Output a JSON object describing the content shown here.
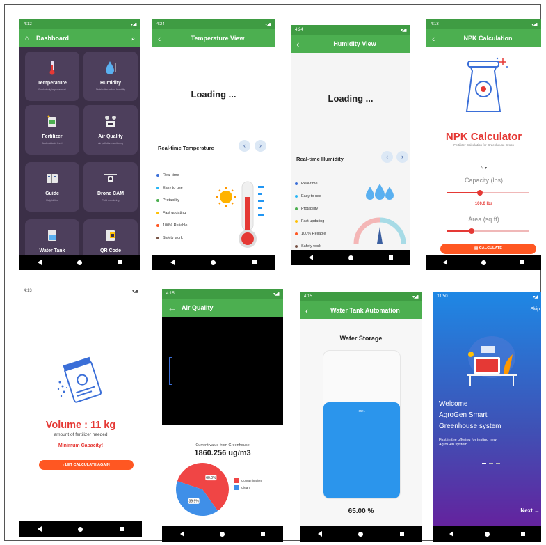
{
  "dashboard": {
    "time": "4:12",
    "title": "Dashboard",
    "tiles": [
      {
        "title": "Temperature",
        "sub": "Productivity improvement"
      },
      {
        "title": "Humidity",
        "sub": "Distribution indoor humidity"
      },
      {
        "title": "Fertilizer",
        "sub": "Add nutrients level"
      },
      {
        "title": "Air Quality",
        "sub": "Air pollution monitoring"
      },
      {
        "title": "Guide",
        "sub": "Helpful tips"
      },
      {
        "title": "Drone CAM",
        "sub": "Field monitoring"
      },
      {
        "title": "Water Tank",
        "sub": "Indicating water level and"
      },
      {
        "title": "QR Code",
        "sub": "Indicating your device and"
      }
    ]
  },
  "temperature": {
    "time": "4:24",
    "title": "Temperature View",
    "loading": "Loading ...",
    "section": "Real-time Temperature",
    "features": [
      "Real-time",
      "Easy to use",
      "Protability",
      "Fast updating",
      "100% Reliable",
      "Safety work"
    ]
  },
  "humidity": {
    "time": "4:24",
    "title": "Humidity View",
    "loading": "Loading ...",
    "section": "Real-time Humidity",
    "features": [
      "Real-time",
      "Easy to use",
      "Protability",
      "Fast updating",
      "100% Reliable",
      "Safety work"
    ]
  },
  "npk": {
    "time": "4:13",
    "title": "NPK Calculation",
    "heading": "NPK Calculator",
    "subheading": "Fertilizer Calculation for Greenhouse Crops",
    "dropdown": "N",
    "capacity_label": "Capacity (lbs)",
    "capacity_value": "100.0 lbs",
    "capacity_level": 0.4,
    "area_label": "Area (sq ft)",
    "area_level": 0.3,
    "button": "CALCULATE"
  },
  "volume": {
    "time": "4:13",
    "heading": "Volume : 11 kg",
    "sub": "amount of fertilizer needed",
    "warning": "Minimum Capacity!",
    "button": "LET CALCULATE AGAIN"
  },
  "air": {
    "time": "4:15",
    "title": "Air Quality",
    "caption": "Current value from Greenhouse",
    "value": "1860.256 ug/m3",
    "chart_data": {
      "type": "pie",
      "categories": [
        "Contamination",
        "Clean"
      ],
      "values": [
        60.0,
        39.9
      ],
      "labels": [
        "60.0%",
        "39.9%"
      ],
      "colors": [
        "#f04545",
        "#3f8fe8"
      ],
      "legend": "right"
    }
  },
  "water": {
    "time": "4:15",
    "title": "Water Tank Automation",
    "heading": "Water Storage",
    "level_label": "65%",
    "level": 0.65,
    "reading": "65.00 %"
  },
  "welcome": {
    "time": "11:50",
    "skip": "Skip",
    "line1": "Welcome",
    "line2": "AgroGen Smart",
    "line3": "Greenhouse system",
    "desc1": "First in the offering for testing new",
    "desc2": "AgroGen system",
    "next": "Next"
  },
  "colors": {
    "appbar": "#4caf50",
    "accent_red": "#e53935",
    "accent_orange": "#ff5722",
    "dashboard_bg": "#3b2f47",
    "tile_bg": "#4d3f5c"
  }
}
